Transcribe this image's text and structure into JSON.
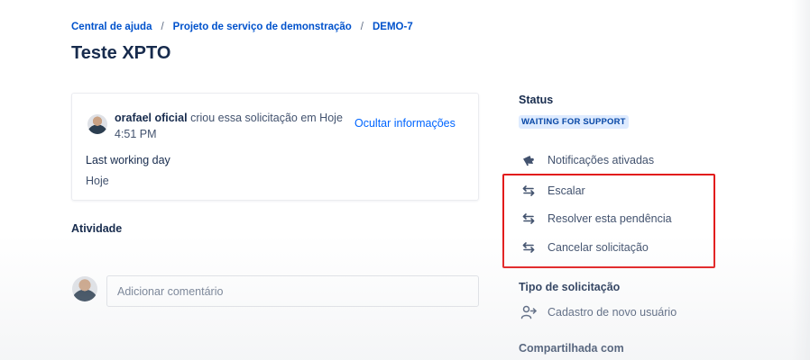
{
  "breadcrumb": {
    "items": [
      "Central de ajuda",
      "Projeto de serviço de demonstração",
      "DEMO-7"
    ],
    "separator": "/"
  },
  "issue": {
    "title": "Teste XPTO"
  },
  "request_card": {
    "author": "orafael oficial",
    "action_text": " criou essa solicitação em Hoje 4:51 PM",
    "hide_info_label": "Ocultar informações",
    "field_label": "Last working day",
    "field_value": "Hoje"
  },
  "activity": {
    "heading": "Atividade",
    "comment_placeholder": "Adicionar comentário"
  },
  "sidebar": {
    "status_label": "Status",
    "status_value": "WAITING FOR SUPPORT",
    "notifications_label": "Notificações ativadas",
    "actions": [
      {
        "label": "Escalar",
        "icon": "transition-arrows-icon"
      },
      {
        "label": "Resolver esta pendência",
        "icon": "transition-arrows-icon"
      },
      {
        "label": "Cancelar solicitação",
        "icon": "transition-arrows-icon"
      }
    ],
    "request_type_label": "Tipo de solicitação",
    "request_type_value": "Cadastro de novo usuário",
    "shared_with_label": "Compartilhada com"
  },
  "colors": {
    "link": "#0052cc",
    "status_badge_bg": "#deebff",
    "status_badge_text": "#0747a6",
    "highlight": "#e21b1b"
  }
}
